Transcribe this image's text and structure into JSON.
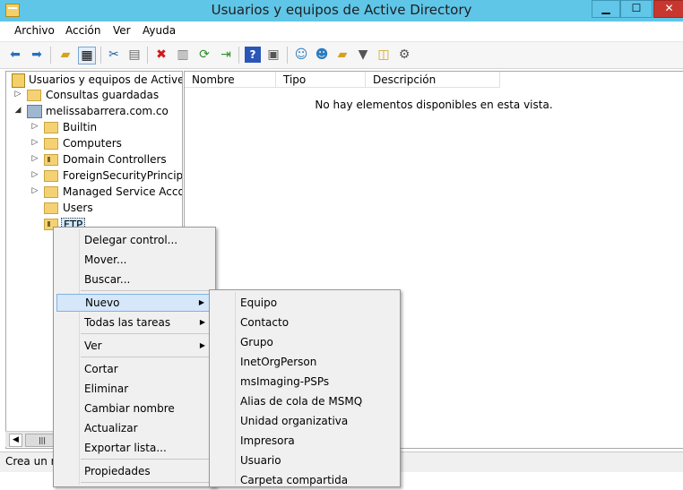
{
  "window": {
    "title": "Usuarios y equipos de Active Directory",
    "minimize": "▁",
    "maximize": "☐",
    "close": "✕"
  },
  "menubar": [
    "Archivo",
    "Acción",
    "Ver",
    "Ayuda"
  ],
  "toolbar": {
    "icons": [
      "back-icon",
      "forward-icon",
      "up-folder-icon",
      "show-tree-icon",
      "cut-icon",
      "copy-icon",
      "delete-icon",
      "properties-icon",
      "refresh-icon",
      "export-icon",
      "help-icon",
      "mmc-icon",
      "add-user-icon",
      "add-group-icon",
      "add-ou-icon",
      "filter-icon",
      "find-icon",
      "delegate-icon"
    ]
  },
  "tree": {
    "root": "Usuarios y equipos de Active Dir",
    "saved_queries": "Consultas guardadas",
    "domain": "melissabarrera.com.co",
    "items": [
      {
        "label": "Builtin",
        "expandable": true
      },
      {
        "label": "Computers",
        "expandable": true
      },
      {
        "label": "Domain Controllers",
        "expandable": true
      },
      {
        "label": "ForeignSecurityPrincipals",
        "expandable": true
      },
      {
        "label": "Managed Service Accour",
        "expandable": true
      },
      {
        "label": "Users",
        "expandable": false
      },
      {
        "label": "FTP",
        "expandable": false
      }
    ]
  },
  "list": {
    "columns": [
      "Nombre",
      "Tipo",
      "Descripción"
    ],
    "empty_message": "No hay elementos disponibles en esta vista."
  },
  "status": {
    "text": "Crea un n"
  },
  "context_menu": {
    "items": [
      {
        "label": "Delegar control...",
        "submenu": false
      },
      {
        "label": "Mover...",
        "submenu": false
      },
      {
        "label": "Buscar...",
        "submenu": false
      },
      {
        "label": "Nuevo",
        "submenu": true,
        "highlighted": true
      },
      {
        "label": "Todas las tareas",
        "submenu": true
      },
      {
        "label": "Ver",
        "submenu": true
      },
      {
        "label": "Cortar",
        "submenu": false
      },
      {
        "label": "Eliminar",
        "submenu": false
      },
      {
        "label": "Cambiar nombre",
        "submenu": false
      },
      {
        "label": "Actualizar",
        "submenu": false
      },
      {
        "label": "Exportar lista...",
        "submenu": false
      },
      {
        "label": "Propiedades",
        "submenu": false
      }
    ]
  },
  "submenu_nuevo": {
    "items": [
      "Equipo",
      "Contacto",
      "Grupo",
      "InetOrgPerson",
      "msImaging-PSPs",
      "Alias de cola de MSMQ",
      "Unidad organizativa",
      "Impresora",
      "Usuario",
      "Carpeta compartida"
    ]
  }
}
